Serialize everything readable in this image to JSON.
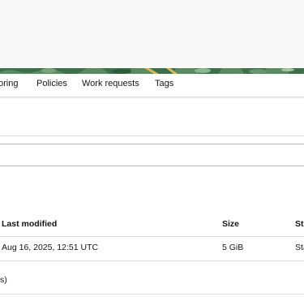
{
  "tabs": [
    {
      "label": "oring"
    },
    {
      "label": "Policies"
    },
    {
      "label": "Work requests"
    },
    {
      "label": "Tags"
    }
  ],
  "table": {
    "headers": [
      "Last modified",
      "Size",
      "St"
    ],
    "rows": [
      {
        "last_modified": "Aug 16, 2025, 12:51 UTC",
        "size": "5 GiB",
        "status": "Sta"
      }
    ]
  },
  "footer": {
    "text": "s)"
  },
  "colors": {
    "accent_pattern_green": "#3e6e4b",
    "pattern_yellow": "#d9b85a"
  }
}
